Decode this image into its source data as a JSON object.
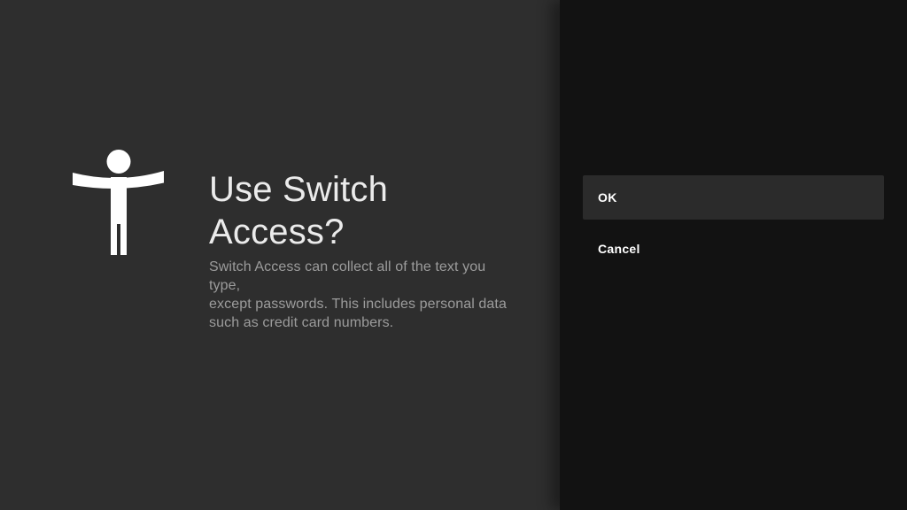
{
  "dialog": {
    "title_lines": [
      "Use Switch",
      "Access?"
    ],
    "description_lines": [
      "Switch Access can collect all of the text you type,",
      "except passwords. This includes personal data",
      "such as credit card numbers."
    ],
    "icon": "accessibility-person-icon",
    "actions": [
      {
        "label": "OK",
        "focused": true
      },
      {
        "label": "Cancel",
        "focused": false
      }
    ]
  },
  "colors": {
    "content_background": "#2e2e2e",
    "action_panel_background": "#121212",
    "focused_action_background": "#2b2b2b",
    "title_text": "#ebebeb",
    "description_text": "#9c9c9c",
    "action_text": "#ffffff",
    "icon_fill": "#ffffff"
  }
}
